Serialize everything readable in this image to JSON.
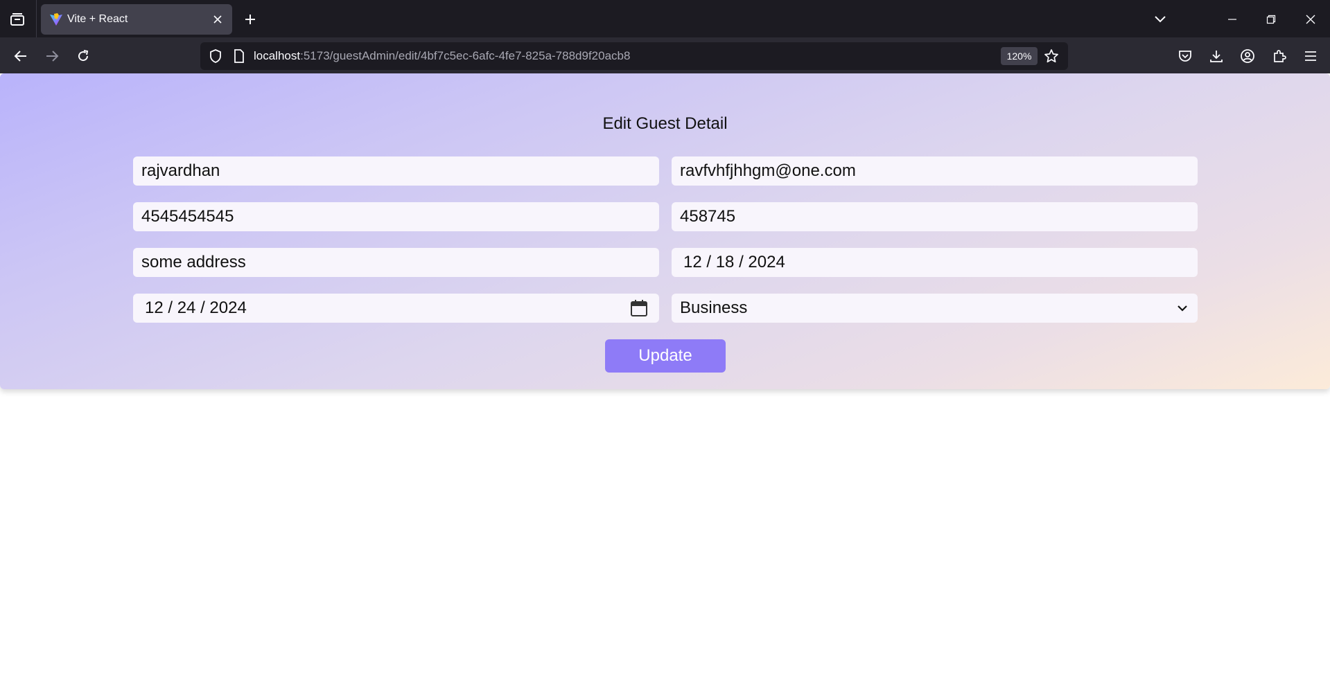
{
  "browser": {
    "tab": {
      "title": "Vite + React"
    },
    "url": {
      "host": "localhost",
      "path": ":5173/guestAdmin/edit/4bf7c5ec-6afc-4fe7-825a-788d9f20acb8"
    },
    "zoom": "120%"
  },
  "form": {
    "title": "Edit Guest Detail",
    "name": "rajvardhan",
    "email": "ravfvhfjhhgm@one.com",
    "phone": "4545454545",
    "pincode": "458745",
    "address": "some address",
    "check_in_date": "12 / 18 / 2024",
    "check_out_date": "12 / 24 / 2024",
    "purpose": "Business",
    "update_label": "Update"
  },
  "colors": {
    "button": "#8e7bf7",
    "gradient_start": "#b9b3fb",
    "gradient_end": "#fcebd9"
  },
  "icons": [
    "tab-list-icon",
    "vite-favicon-icon",
    "close-icon",
    "plus-icon",
    "chevron-down-icon",
    "minimize-icon",
    "restore-icon",
    "back-icon",
    "forward-icon",
    "reload-icon",
    "shield-icon",
    "page-icon",
    "star-icon",
    "pocket-icon",
    "download-icon",
    "account-icon",
    "extensions-icon",
    "menu-icon",
    "calendar-icon"
  ]
}
